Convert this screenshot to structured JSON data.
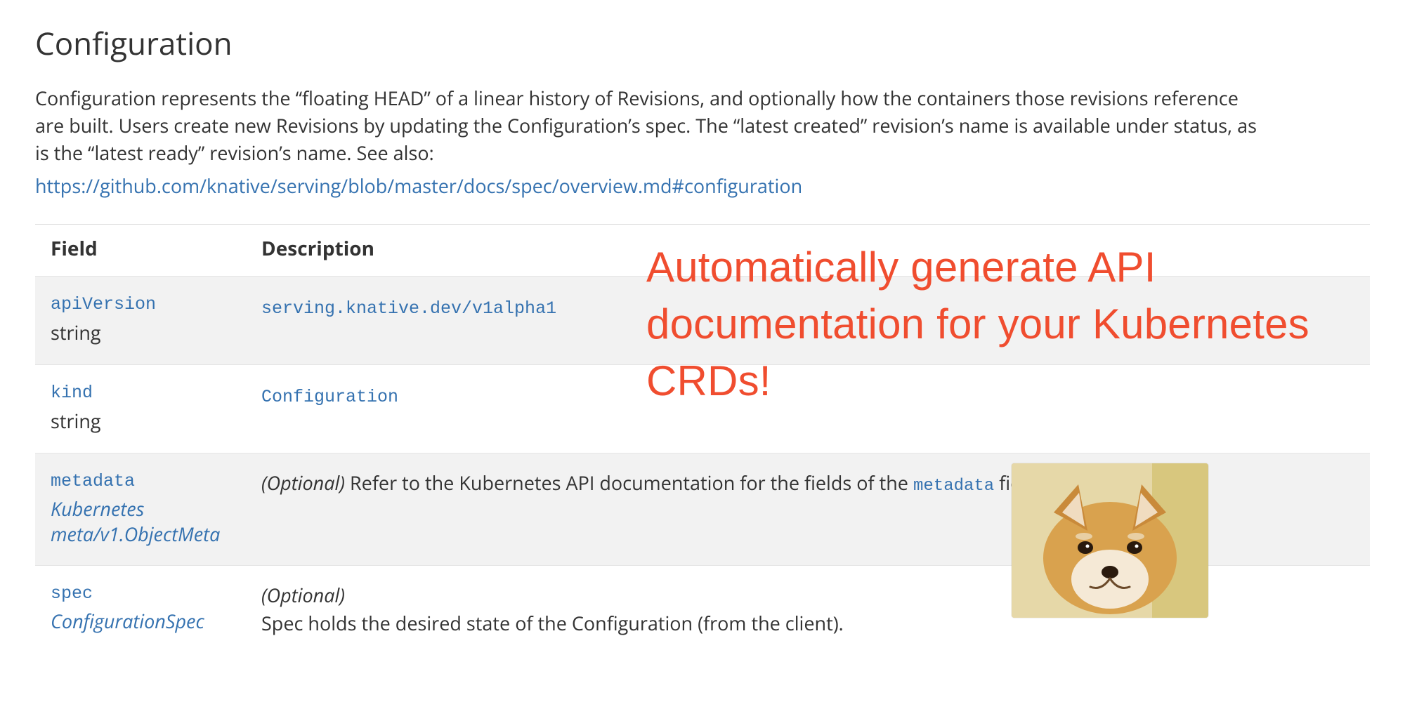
{
  "title": "Configuration",
  "intro_text": "Configuration represents the “floating HEAD” of a linear history of Revisions, and optionally how the containers those revisions reference are built. Users create new Revisions by updating the Configuration’s spec. The “latest created” revision’s name is available under status, as is the “latest ready” revision’s name. See also:",
  "intro_link": "https://github.com/knative/serving/blob/master/docs/spec/overview.md#configuration",
  "table": {
    "header_field": "Field",
    "header_desc": "Description",
    "rows": {
      "r0": {
        "name": "apiVersion",
        "type": "string",
        "desc_code": "serving.knative.dev/v1alpha1"
      },
      "r1": {
        "name": "kind",
        "type": "string",
        "desc_code": "Configuration"
      },
      "r2": {
        "name": "metadata",
        "type_link": "Kubernetes meta/v1.ObjectMeta",
        "optional": "(Optional)",
        "desc_pre": " Refer to the Kubernetes API documentation for the fields of the ",
        "desc_code": "metadata",
        "desc_post": " field."
      },
      "r3": {
        "name": "spec",
        "type_link": "ConfigurationSpec",
        "optional": "(Optional)",
        "desc": "Spec holds the desired state of the Configuration (from the client)."
      }
    }
  },
  "overlay_headline": "Automatically generate API documentation for your Kubernetes CRDs!",
  "overlay_image_alt": "Doge meme image"
}
